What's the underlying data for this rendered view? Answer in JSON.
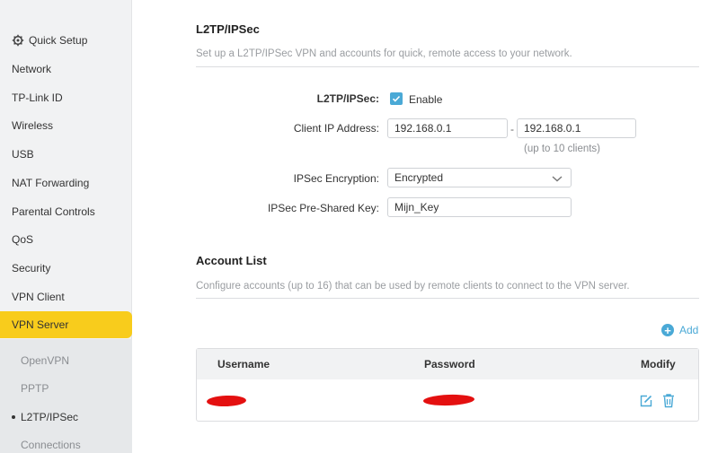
{
  "sidebar": {
    "items": [
      {
        "label": "Quick Setup",
        "icon": "gear-icon"
      },
      {
        "label": "Network"
      },
      {
        "label": "TP-Link ID"
      },
      {
        "label": "Wireless"
      },
      {
        "label": "USB"
      },
      {
        "label": "NAT Forwarding"
      },
      {
        "label": "Parental Controls"
      },
      {
        "label": "QoS"
      },
      {
        "label": "Security"
      },
      {
        "label": "VPN Client"
      },
      {
        "label": "VPN Server"
      }
    ],
    "active": "VPN Server",
    "subitems": [
      "OpenVPN",
      "PPTP",
      "L2TP/IPSec",
      "Connections"
    ],
    "current_sub": "L2TP/IPSec"
  },
  "l2tp": {
    "title": "L2TP/IPSec",
    "description": "Set up a L2TP/IPSec VPN and accounts for quick, remote access to your network.",
    "enable_label": "L2TP/IPSec:",
    "enable_text": "Enable",
    "enabled": true,
    "client_ip_label": "Client IP Address:",
    "client_ip_start": "192.168.0.1",
    "client_ip_end": "192.168.0.1",
    "separator": "-",
    "client_hint": "(up to 10 clients)",
    "encryption_label": "IPSec Encryption:",
    "encryption_value": "Encrypted",
    "psk_label": "IPSec Pre-Shared Key:",
    "psk_value": "Mijn_Key"
  },
  "accounts": {
    "title": "Account List",
    "description": "Configure accounts (up to 16) that can be used by remote clients to connect to the VPN server.",
    "add_label": "Add",
    "columns": [
      "Username",
      "Password",
      "Modify"
    ]
  },
  "colors": {
    "accent": "#4aa9d6",
    "active_nav": "#f8cc1c",
    "redaction": "#e41010"
  }
}
